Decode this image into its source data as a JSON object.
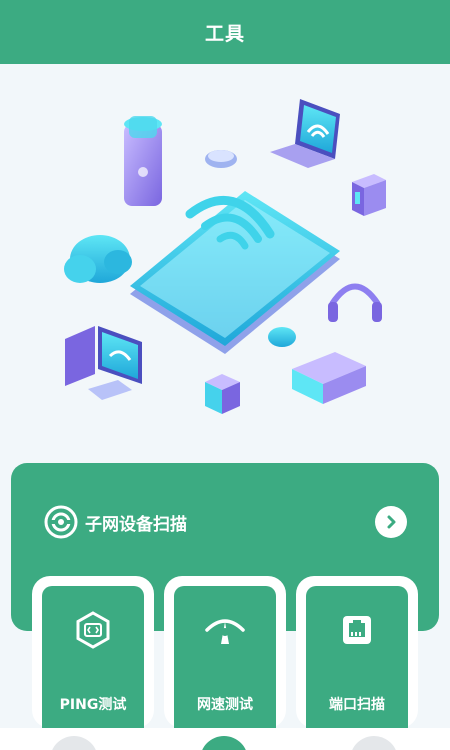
{
  "header": {
    "title": "工具"
  },
  "subnet_scan": {
    "label": "子网设备扫描"
  },
  "tools": [
    {
      "label": "PING测试",
      "icon": "ping-hexagon-icon"
    },
    {
      "label": "网速测试",
      "icon": "speed-gauge-icon"
    },
    {
      "label": "端口扫描",
      "icon": "ethernet-port-icon"
    }
  ],
  "tabbar": {
    "items": [
      {
        "icon": "home-icon"
      },
      {
        "icon": "toolbox-icon"
      },
      {
        "icon": "search-icon"
      }
    ]
  },
  "colors": {
    "primary": "#3cab82",
    "background": "#f2f7fa",
    "accent_cyan": "#38d0e8",
    "accent_purple": "#9b8cf0"
  }
}
